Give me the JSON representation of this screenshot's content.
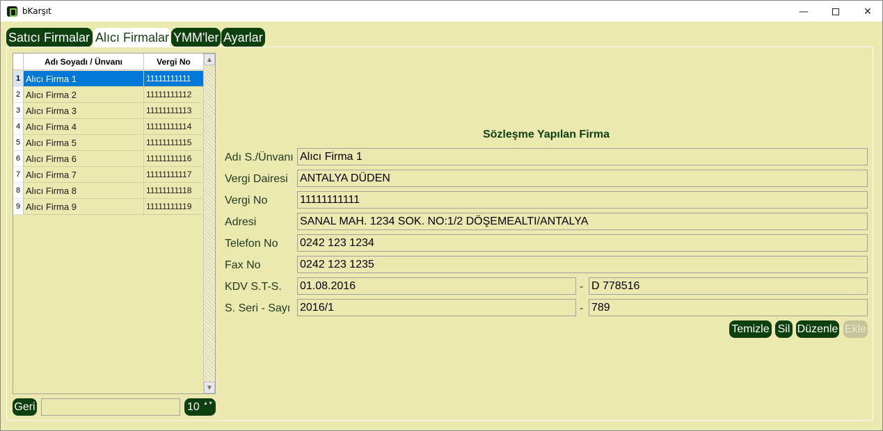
{
  "window": {
    "title": "bKarşıt",
    "min_glyph": "—",
    "close_glyph": "✕"
  },
  "tabs": [
    {
      "label": "Satıcı Firmalar",
      "active": false
    },
    {
      "label": "Alıcı Firmalar",
      "active": true
    },
    {
      "label": "YMM'ler",
      "active": false
    },
    {
      "label": "Ayarlar",
      "active": false
    }
  ],
  "grid": {
    "columns": {
      "name": "Adı Soyadı / Ünvanı",
      "vergi": "Vergi No"
    },
    "rows": [
      {
        "index": "1",
        "name": "Alıcı Firma 1",
        "vergi": "11111111111",
        "selected": true
      },
      {
        "index": "2",
        "name": "Alıcı Firma 2",
        "vergi": "11111111112"
      },
      {
        "index": "3",
        "name": "Alıcı Firma 3",
        "vergi": "11111111113"
      },
      {
        "index": "4",
        "name": "Alıcı Firma 4",
        "vergi": "11111111114"
      },
      {
        "index": "5",
        "name": "Alıcı Firma 5",
        "vergi": "11111111115"
      },
      {
        "index": "6",
        "name": "Alıcı Firma 6",
        "vergi": "11111111116"
      },
      {
        "index": "7",
        "name": "Alıcı Firma 7",
        "vergi": "11111111117"
      },
      {
        "index": "8",
        "name": "Alıcı Firma 8",
        "vergi": "11111111118"
      },
      {
        "index": "9",
        "name": "Alıcı Firma 9",
        "vergi": "11111111119"
      }
    ],
    "scroll_up": "▲",
    "scroll_down": "▼"
  },
  "pager": {
    "back_label": "Geri",
    "search_value": "",
    "page_size": "10",
    "spin_glyph": "▲▼"
  },
  "form": {
    "title": "Sözleşme Yapılan Firma",
    "unvan_label": "Adı S./Ünvanı",
    "unvan_value": "Alıcı Firma 1",
    "vergi_dairesi_label": "Vergi Dairesi",
    "vergi_dairesi_value": "ANTALYA DÜDEN",
    "vergi_no_label": "Vergi No",
    "vergi_no_value": "11111111111",
    "adres_label": "Adresi",
    "adres_value": "SANAL MAH. 1234 SOK. NO:1/2 DÖŞEMEALTI/ANTALYA",
    "telefon_label": "Telefon No",
    "telefon_value": "0242 123 1234",
    "fax_label": "Fax No",
    "fax_value": "0242 123 1235",
    "kdv_label": "KDV S.T-S.",
    "kdv_date": "01.08.2016",
    "kdv_no": "D 778516",
    "seri_label": "S. Seri - Sayı",
    "seri_value": "2016/1",
    "sayi_value": "789",
    "dash": "-"
  },
  "actions": {
    "temizle": "Temizle",
    "sil": "Sil",
    "duzenle": "Düzenle",
    "ekle": "Ekle"
  },
  "colors": {
    "background": "#ebe8b0",
    "button": "#0e3f0e",
    "selection": "#0078d7",
    "disabled": "#c6c49c"
  }
}
